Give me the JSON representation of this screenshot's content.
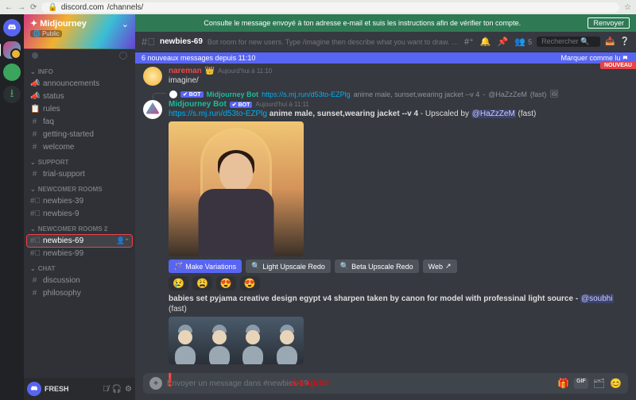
{
  "browser": {
    "url_host": "discord.com",
    "url_path": "/channels/"
  },
  "banner": {
    "text": "Consulte le message envoyé à ton adresse e-mail et suis les instructions afin de vérifier ton compte.",
    "button": "Renvoyer"
  },
  "server": {
    "name": "Midjourney",
    "visibility": "Public"
  },
  "categories": [
    {
      "label": "INFO",
      "icon": "chevron-down",
      "channels": [
        {
          "icon": "megaphone",
          "name": "announcements"
        },
        {
          "icon": "megaphone",
          "name": "status"
        },
        {
          "icon": "rules",
          "name": "rules"
        },
        {
          "icon": "hash",
          "name": "faq"
        },
        {
          "icon": "hash",
          "name": "getting-started"
        },
        {
          "icon": "hash",
          "name": "welcome"
        }
      ]
    },
    {
      "label": "SUPPORT",
      "icon": "chevron-down",
      "channels": [
        {
          "icon": "hash",
          "name": "trial-support"
        }
      ]
    },
    {
      "label": "NEWCOMER ROOMS",
      "icon": "chevron-down",
      "channels": [
        {
          "icon": "hash-chat",
          "name": "newbies-39"
        },
        {
          "icon": "hash-chat",
          "name": "newbies-9"
        }
      ]
    },
    {
      "label": "NEWCOMER ROOMS 2",
      "icon": "chevron-down",
      "channels": [
        {
          "icon": "hash-chat",
          "name": "newbies-69",
          "selected": true,
          "highlight": true,
          "add": true
        },
        {
          "icon": "hash-chat",
          "name": "newbies-99"
        }
      ]
    },
    {
      "label": "CHAT",
      "icon": "chevron-down",
      "channels": [
        {
          "icon": "hash",
          "name": "discussion"
        },
        {
          "icon": "hash",
          "name": "philosophy"
        }
      ]
    }
  ],
  "user": {
    "name": "FRESH"
  },
  "channel_header": {
    "name": "newbies-69",
    "topic": "Bot room for new users. Type /imagine then describe what you want to draw. See",
    "topic_link": "https://m...",
    "members": "5",
    "search_placeholder": "Rechercher"
  },
  "new_messages": {
    "left": "6 nouveaux messages depuis 11:10",
    "right": "Marquer comme lu",
    "tag": "NOUVEAU"
  },
  "messages": {
    "m1": {
      "author": "nareman",
      "ts": "Aujourd'hui à 11:10",
      "content": "imagine/"
    },
    "reply": {
      "bot": "Midjourney Bot",
      "bot_tag": "✔ BOT",
      "url": "https://s.mj.run/d53to-EZPlg",
      "text": " anime male, sunset,wearing jacket --v 4",
      "mention": "@HaZzZeM",
      "tail": " (fast)"
    },
    "m2": {
      "author": "Midjourney Bot",
      "bot_tag": "✔ BOT",
      "ts": "Aujourd'hui à 11:11",
      "url": "https://s.mj.run/d53to-EZPlg",
      "bold": " anime male, sunset,wearing jacket --v 4",
      "mid": " - Upscaled by ",
      "mention": "@HaZzZeM",
      "tail": " (fast)"
    },
    "buttons": {
      "b1": "Make Variations",
      "b2": "Light Upscale Redo",
      "b3": "Beta Upscale Redo",
      "b4": "Web"
    },
    "reactions": [
      "😢",
      "😩",
      "😍",
      "😍"
    ],
    "m3": {
      "pre": "babies set pyjama creative design egypt v4 sharpen taken by canon for model with professinal light source - ",
      "mention": "@soubhi",
      "tail": " (fast)"
    }
  },
  "composer": {
    "placeholder": "Envoyer un message dans #newbies-69",
    "overlay": "/imagine",
    "gif": "GIF"
  }
}
